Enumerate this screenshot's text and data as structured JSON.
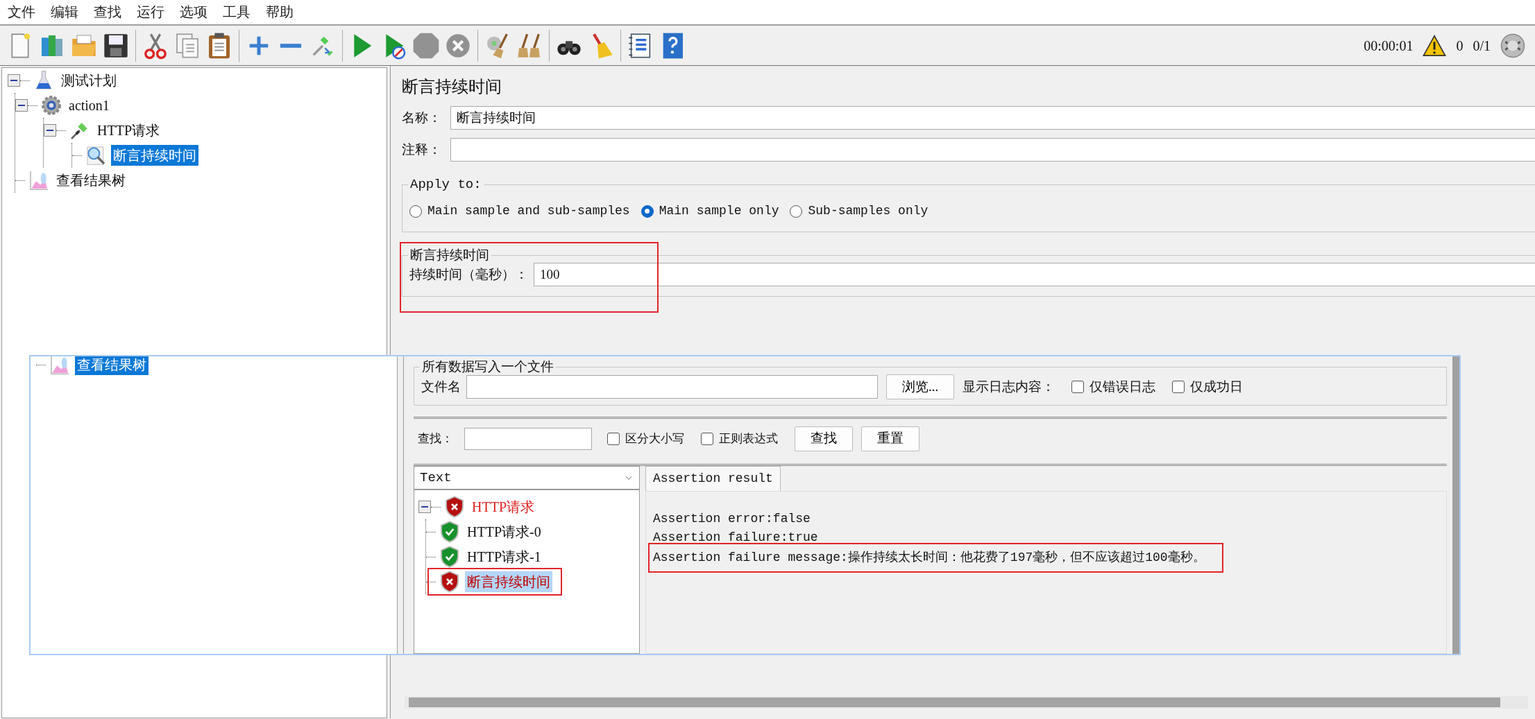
{
  "menu": [
    "文件",
    "编辑",
    "查找",
    "运行",
    "选项",
    "工具",
    "帮助"
  ],
  "toolbar_groups": [
    {
      "buttons": [
        {
          "kind": "new",
          "disabled": false
        },
        {
          "kind": "templates",
          "disabled": false
        },
        {
          "kind": "open",
          "disabled": false
        },
        {
          "kind": "save",
          "disabled": false
        }
      ]
    },
    {
      "buttons": [
        {
          "kind": "cut",
          "disabled": false
        },
        {
          "kind": "copy",
          "disabled": false
        },
        {
          "kind": "paste",
          "disabled": false
        }
      ]
    },
    {
      "buttons": [
        {
          "kind": "expand",
          "disabled": false
        },
        {
          "kind": "collapse",
          "disabled": false
        },
        {
          "kind": "toggle",
          "disabled": false
        }
      ]
    },
    {
      "buttons": [
        {
          "kind": "start",
          "disabled": false
        },
        {
          "kind": "start_no_pause",
          "disabled": false
        },
        {
          "kind": "stop",
          "disabled": true
        },
        {
          "kind": "shutdown",
          "disabled": true
        }
      ]
    },
    {
      "buttons": [
        {
          "kind": "clear",
          "disabled": false
        },
        {
          "kind": "clear_all",
          "disabled": false
        }
      ]
    },
    {
      "buttons": [
        {
          "kind": "search",
          "disabled": false
        },
        {
          "kind": "reset_search",
          "disabled": false
        }
      ]
    },
    {
      "buttons": [
        {
          "kind": "function_helper",
          "disabled": false
        },
        {
          "kind": "help",
          "disabled": false
        }
      ]
    }
  ],
  "status": {
    "elapsed": "00:00:01",
    "warnings": "0",
    "threads": "0/1"
  },
  "tree": [
    {
      "kind": "test_plan",
      "label": "测试计划",
      "expanded": true,
      "selected": false,
      "children": [
        {
          "kind": "thread_group",
          "label": "action1",
          "expanded": true,
          "selected": false,
          "children": [
            {
              "kind": "sampler",
              "label": "HTTP请求",
              "expanded": true,
              "selected": false,
              "children": [
                {
                  "kind": "assertion",
                  "label": "断言持续时间",
                  "selected": true
                }
              ]
            }
          ]
        },
        {
          "kind": "listener",
          "label": "查看结果树",
          "selected": false
        }
      ]
    }
  ],
  "editor": {
    "title": "断言持续时间",
    "fields": [
      {
        "label": "名称：",
        "value": "断言持续时间"
      },
      {
        "label": "注释："
      }
    ],
    "apply_to": {
      "legend": "Apply to:",
      "options": [
        {
          "label": "Main sample and sub-samples",
          "selected": false
        },
        {
          "label": "Main sample only",
          "selected": true
        },
        {
          "label": "Sub-samples only",
          "selected": false
        }
      ]
    },
    "duration": {
      "legend": "断言持续时间",
      "label": "持续时间（毫秒）：",
      "value": "100"
    }
  },
  "overlay": {
    "tree_item": {
      "kind": "listener",
      "label": "查看结果树",
      "selected": true
    },
    "file_group": {
      "legend": "所有数据写入一个文件",
      "label": "文件名",
      "browse": "浏览...",
      "log_label": "显示日志内容：",
      "options": [
        {
          "label": "仅错误日志",
          "checked": false
        },
        {
          "label": "仅成功日",
          "checked": false
        }
      ]
    },
    "search": {
      "label": "查找：",
      "options": [
        {
          "label": "区分大小写",
          "checked": false
        },
        {
          "label": "正则表达式",
          "checked": false
        }
      ],
      "buttons": [
        "查找",
        "重置"
      ]
    },
    "renderer": "Text",
    "results": [
      {
        "failed": true,
        "label": "HTTP请求",
        "expanded": true,
        "selected": false,
        "children": [
          {
            "failed": false,
            "label": "HTTP请求-0",
            "selected": false
          },
          {
            "failed": false,
            "label": "HTTP请求-1",
            "selected": false
          },
          {
            "failed": true,
            "label": "断言持续时间",
            "selected": true
          }
        ]
      }
    ],
    "tabs": [
      {
        "label": "Assertion result",
        "selected": true
      }
    ],
    "lines": [
      "Assertion error:false",
      "Assertion failure:true",
      "Assertion failure message:操作持续太长时间：他花费了197毫秒，但不应该超过100毫秒。"
    ]
  }
}
